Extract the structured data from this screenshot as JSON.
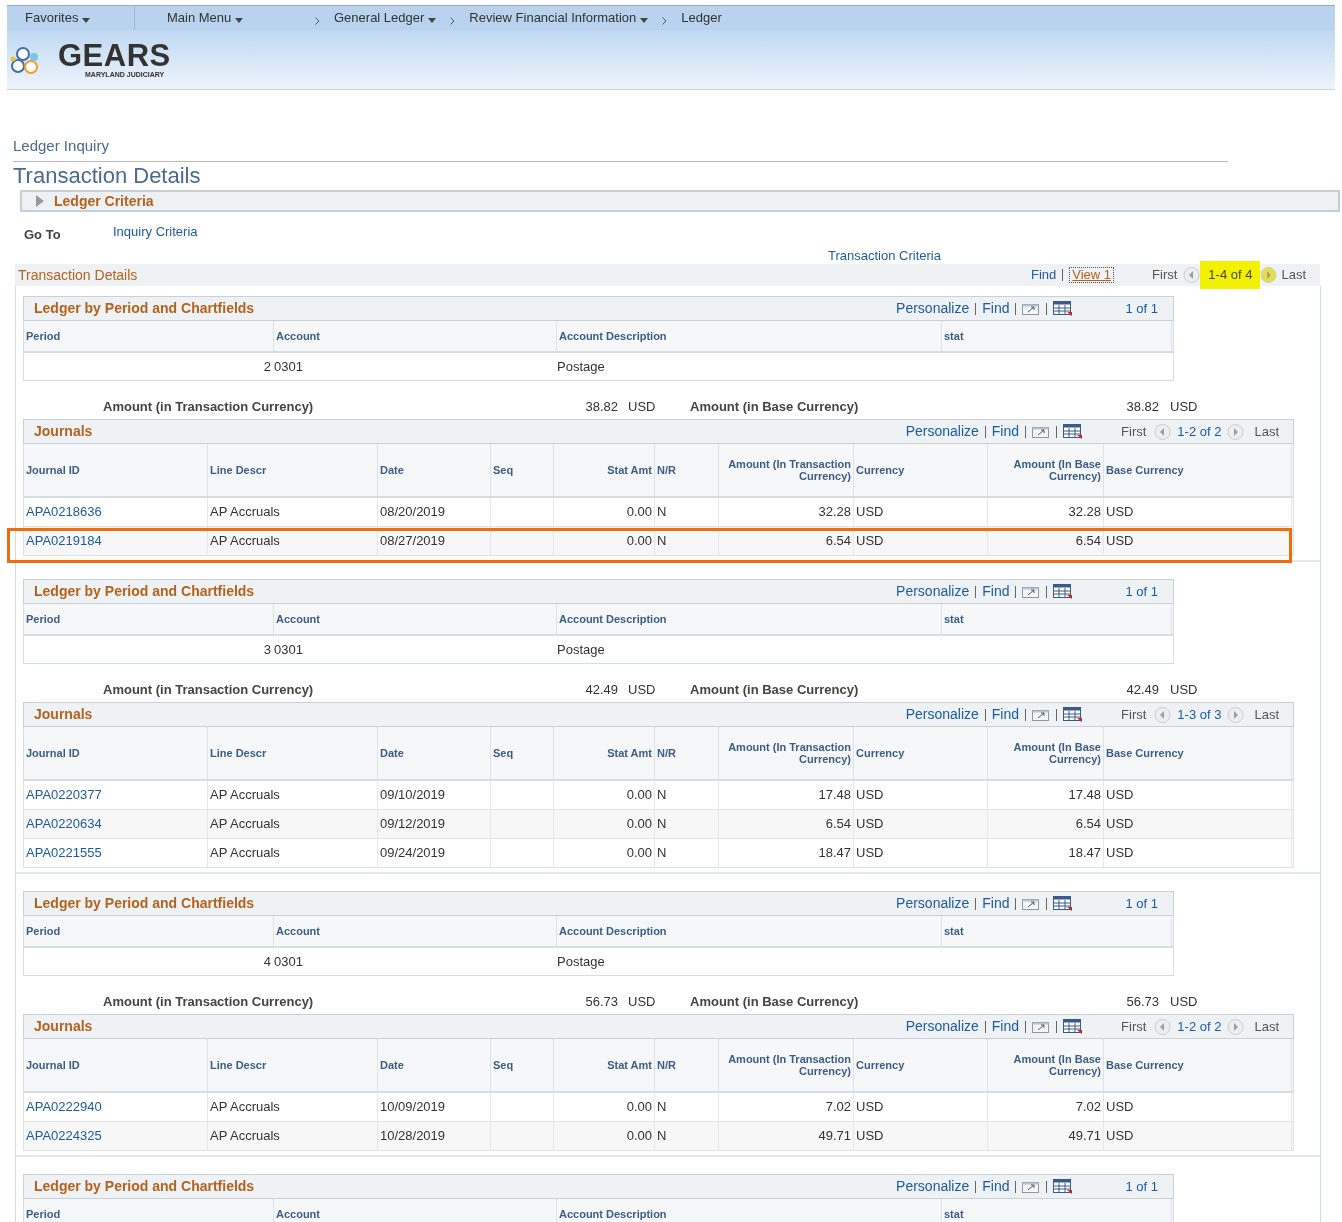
{
  "nav": [
    {
      "kind": "menu",
      "label": "Favorites",
      "dropdown": true
    },
    {
      "kind": "menu",
      "label": "Main Menu",
      "dropdown": true
    },
    {
      "kind": "crumb",
      "label": "General Ledger",
      "dropdown": true
    },
    {
      "kind": "crumb",
      "label": "Review Financial Information",
      "dropdown": true
    },
    {
      "kind": "crumb",
      "label": "Ledger",
      "dropdown": false
    }
  ],
  "logo": {
    "name": "GEARS",
    "tagline": "MARYLAND JUDICIARY"
  },
  "page": {
    "parent": "Ledger Inquiry",
    "title": "Transaction Details"
  },
  "ledger_criteria": {
    "label": "Ledger Criteria",
    "expanded": false
  },
  "go_to": {
    "label": "Go To",
    "link": "Inquiry Criteria"
  },
  "transaction_criteria_link": "Transaction Criteria",
  "transaction_details": {
    "title": "Transaction Details",
    "find": "Find",
    "view": "View 1",
    "first": "First",
    "count": "1-4 of 4",
    "count_highlighted": true,
    "last": "Last"
  },
  "groups": [
    {
      "ledger": {
        "title": "Ledger by Period and Chartfields",
        "personalize": "Personalize",
        "find": "Find",
        "count": "1 of 1",
        "columns": [
          "Period",
          "Account",
          "Account Description",
          "stat"
        ],
        "rows": [
          {
            "period": "2",
            "account": "0301",
            "account_description": "Postage"
          }
        ]
      },
      "amounts": {
        "transaction_label": "Amount (in Transaction Currency)",
        "transaction_amount": "38.82",
        "transaction_currency": "USD",
        "base_label": "Amount (in Base Currency)",
        "base_amount": "38.82",
        "base_currency": "USD"
      },
      "journals": {
        "title": "Journals",
        "personalize": "Personalize",
        "find": "Find",
        "first": "First",
        "count": "1-2 of 2",
        "last": "Last",
        "columns": [
          "Journal ID",
          "Line Descr",
          "Date",
          "Seq",
          "Stat Amt",
          "N/R",
          "Amount (In Transaction Currency)",
          "Currency",
          "Amount (In Base Currency)",
          "Base Currency"
        ],
        "rows": [
          {
            "journal_id": "APA0218636",
            "line_descr": "AP Accruals",
            "date": "08/20/2019",
            "stat_amt": "0.00",
            "nr": "N",
            "amount_transaction": "32.28",
            "currency": "USD",
            "amount_base": "32.28",
            "base_currency": "USD",
            "annotated": false
          },
          {
            "journal_id": "APA0219184",
            "line_descr": "AP Accruals",
            "date": "08/27/2019",
            "stat_amt": "0.00",
            "nr": "N",
            "amount_transaction": "6.54",
            "currency": "USD",
            "amount_base": "6.54",
            "base_currency": "USD",
            "annotated": true
          }
        ]
      }
    },
    {
      "ledger": {
        "title": "Ledger by Period and Chartfields",
        "personalize": "Personalize",
        "find": "Find",
        "count": "1 of 1",
        "columns": [
          "Period",
          "Account",
          "Account Description",
          "stat"
        ],
        "rows": [
          {
            "period": "3",
            "account": "0301",
            "account_description": "Postage"
          }
        ]
      },
      "amounts": {
        "transaction_label": "Amount (in Transaction Currency)",
        "transaction_amount": "42.49",
        "transaction_currency": "USD",
        "base_label": "Amount (in Base Currency)",
        "base_amount": "42.49",
        "base_currency": "USD"
      },
      "journals": {
        "title": "Journals",
        "personalize": "Personalize",
        "find": "Find",
        "first": "First",
        "count": "1-3 of 3",
        "last": "Last",
        "columns": [
          "Journal ID",
          "Line Descr",
          "Date",
          "Seq",
          "Stat Amt",
          "N/R",
          "Amount (In Transaction Currency)",
          "Currency",
          "Amount (In Base Currency)",
          "Base Currency"
        ],
        "rows": [
          {
            "journal_id": "APA0220377",
            "line_descr": "AP Accruals",
            "date": "09/10/2019",
            "stat_amt": "0.00",
            "nr": "N",
            "amount_transaction": "17.48",
            "currency": "USD",
            "amount_base": "17.48",
            "base_currency": "USD",
            "annotated": false
          },
          {
            "journal_id": "APA0220634",
            "line_descr": "AP Accruals",
            "date": "09/12/2019",
            "stat_amt": "0.00",
            "nr": "N",
            "amount_transaction": "6.54",
            "currency": "USD",
            "amount_base": "6.54",
            "base_currency": "USD",
            "annotated": false
          },
          {
            "journal_id": "APA0221555",
            "line_descr": "AP Accruals",
            "date": "09/24/2019",
            "stat_amt": "0.00",
            "nr": "N",
            "amount_transaction": "18.47",
            "currency": "USD",
            "amount_base": "18.47",
            "base_currency": "USD",
            "annotated": false
          }
        ]
      }
    },
    {
      "ledger": {
        "title": "Ledger by Period and Chartfields",
        "personalize": "Personalize",
        "find": "Find",
        "count": "1 of 1",
        "columns": [
          "Period",
          "Account",
          "Account Description",
          "stat"
        ],
        "rows": [
          {
            "period": "4",
            "account": "0301",
            "account_description": "Postage"
          }
        ]
      },
      "amounts": {
        "transaction_label": "Amount (in Transaction Currency)",
        "transaction_amount": "56.73",
        "transaction_currency": "USD",
        "base_label": "Amount (in Base Currency)",
        "base_amount": "56.73",
        "base_currency": "USD"
      },
      "journals": {
        "title": "Journals",
        "personalize": "Personalize",
        "find": "Find",
        "first": "First",
        "count": "1-2 of 2",
        "last": "Last",
        "columns": [
          "Journal ID",
          "Line Descr",
          "Date",
          "Seq",
          "Stat Amt",
          "N/R",
          "Amount (In Transaction Currency)",
          "Currency",
          "Amount (In Base Currency)",
          "Base Currency"
        ],
        "rows": [
          {
            "journal_id": "APA0222940",
            "line_descr": "AP Accruals",
            "date": "10/09/2019",
            "stat_amt": "0.00",
            "nr": "N",
            "amount_transaction": "7.02",
            "currency": "USD",
            "amount_base": "7.02",
            "base_currency": "USD",
            "annotated": false
          },
          {
            "journal_id": "APA0224325",
            "line_descr": "AP Accruals",
            "date": "10/28/2019",
            "stat_amt": "0.00",
            "nr": "N",
            "amount_transaction": "49.71",
            "currency": "USD",
            "amount_base": "49.71",
            "base_currency": "USD",
            "annotated": false
          }
        ]
      }
    },
    {
      "ledger": {
        "title": "Ledger by Period and Chartfields",
        "personalize": "Personalize",
        "find": "Find",
        "count": "1 of 1",
        "columns": [
          "Period",
          "Account",
          "Account Description",
          "stat"
        ]
      }
    }
  ]
}
